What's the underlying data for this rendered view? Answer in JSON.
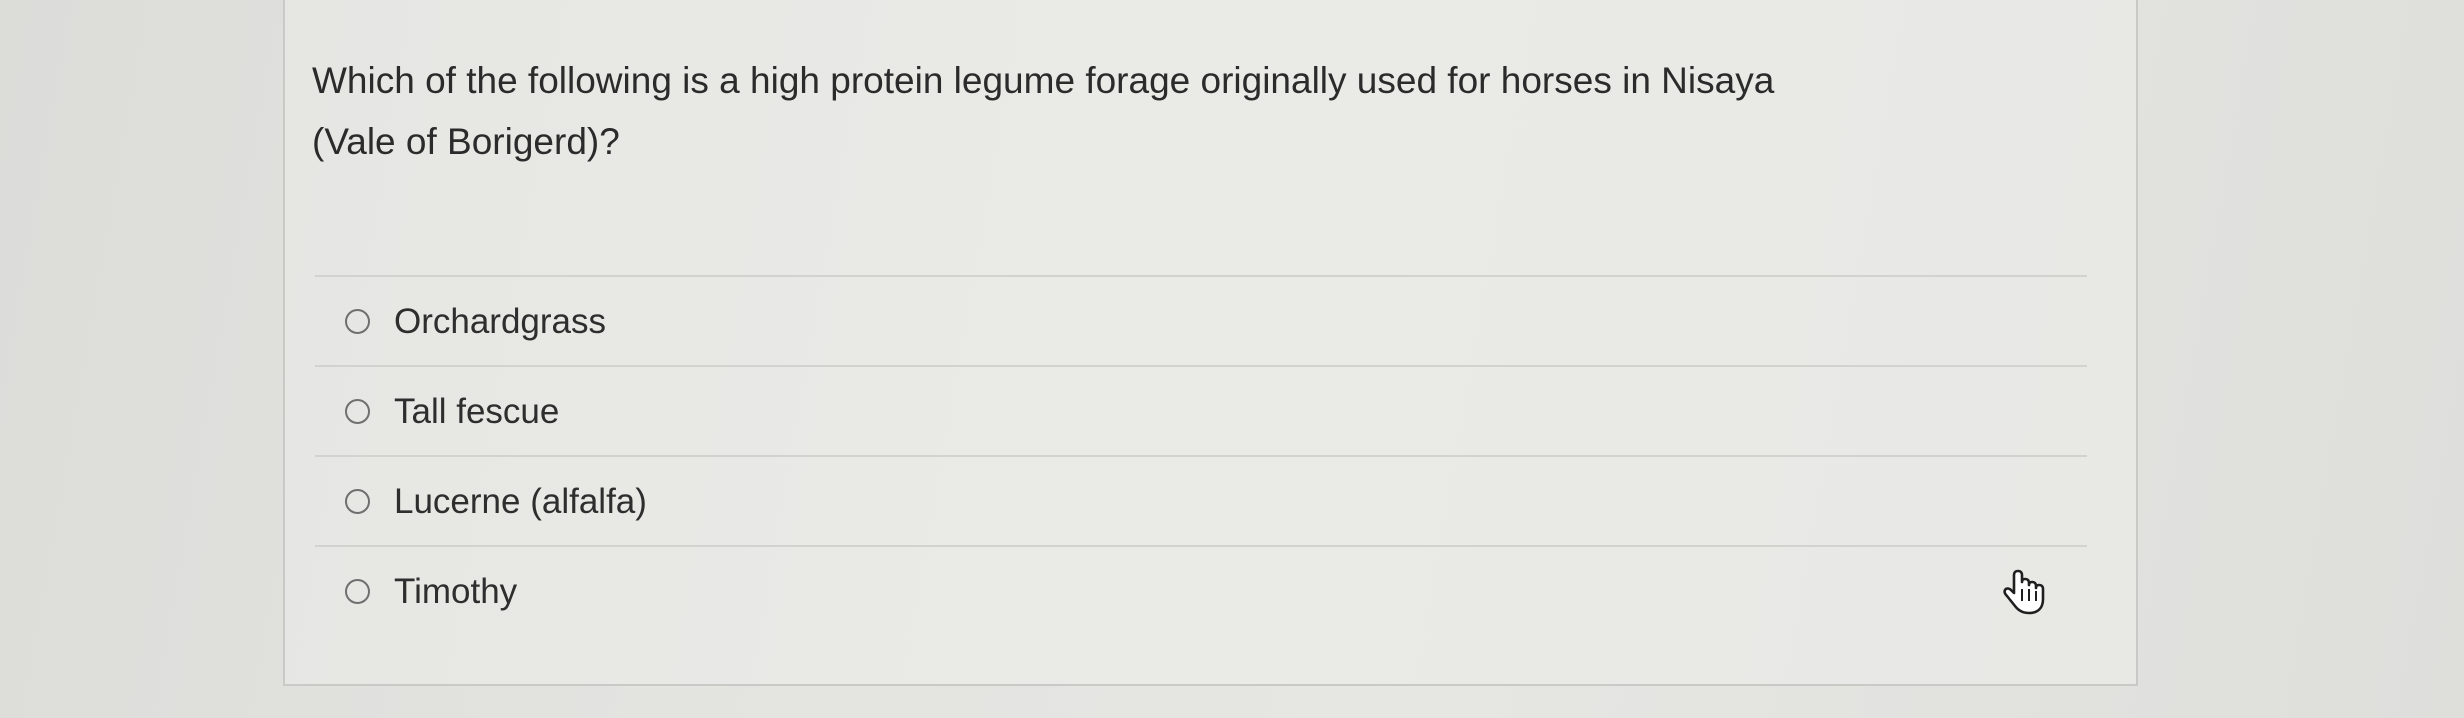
{
  "question": {
    "line1": "Which of the following is a high protein legume forage originally used for horses in Nisaya",
    "line2": "(Vale of Borigerd)?"
  },
  "options": [
    {
      "label": "Orchardgrass",
      "selected": false
    },
    {
      "label": "Tall fescue",
      "selected": false
    },
    {
      "label": "Lucerne (alfalfa)",
      "selected": false
    },
    {
      "label": "Timothy",
      "selected": false
    }
  ],
  "cursor": {
    "icon": "hand-pointer-icon"
  },
  "colors": {
    "background": "#e3e3e0",
    "card": "#e8e8e5",
    "text": "#2b2b2b",
    "divider": "#d2d2cf",
    "radio_border": "#6f6f6f"
  }
}
